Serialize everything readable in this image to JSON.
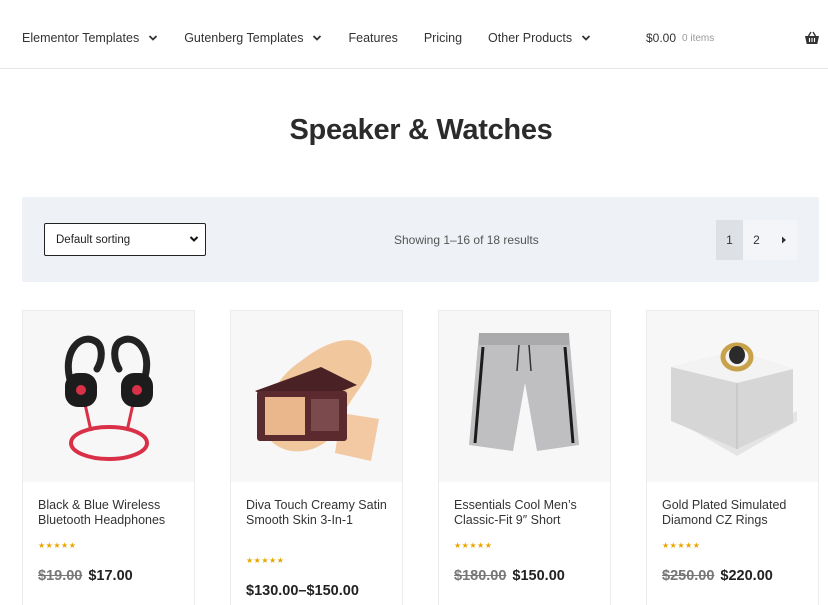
{
  "nav": {
    "items": [
      {
        "label": "Elementor Templates",
        "dropdown": true
      },
      {
        "label": "Gutenberg Templates",
        "dropdown": true
      },
      {
        "label": "Features",
        "dropdown": false
      },
      {
        "label": "Pricing",
        "dropdown": false
      },
      {
        "label": "Other Products",
        "dropdown": true
      }
    ],
    "cart_amount": "$0.00",
    "cart_items": "0 items"
  },
  "page_title": "Speaker & Watches",
  "toolbar": {
    "sort_value": "Default sorting",
    "result_count": "Showing 1–16 of 18 results",
    "pages": [
      "1",
      "2"
    ],
    "current_page": "1"
  },
  "products": [
    {
      "name": "Black & Blue Wireless Bluetooth Headphones",
      "stars": "★★★★★",
      "old_price": "$19.00",
      "price": "$17.00"
    },
    {
      "name": "Diva Touch Creamy Satin Smooth Skin 3-In-1",
      "stars": "★★★★★",
      "old_price": "",
      "price": "$130.00–$150.00"
    },
    {
      "name": "Essentials Cool Men’s Classic-Fit 9″ Short",
      "stars": "★★★★★",
      "old_price": "$180.00",
      "price": "$150.00"
    },
    {
      "name": "Gold Plated Simulated Diamond CZ Rings",
      "stars": "★★★★★",
      "old_price": "$250.00",
      "price": "$220.00"
    }
  ],
  "colors": {
    "star": "#e6a700",
    "toolbar_bg": "#eef1f6"
  }
}
